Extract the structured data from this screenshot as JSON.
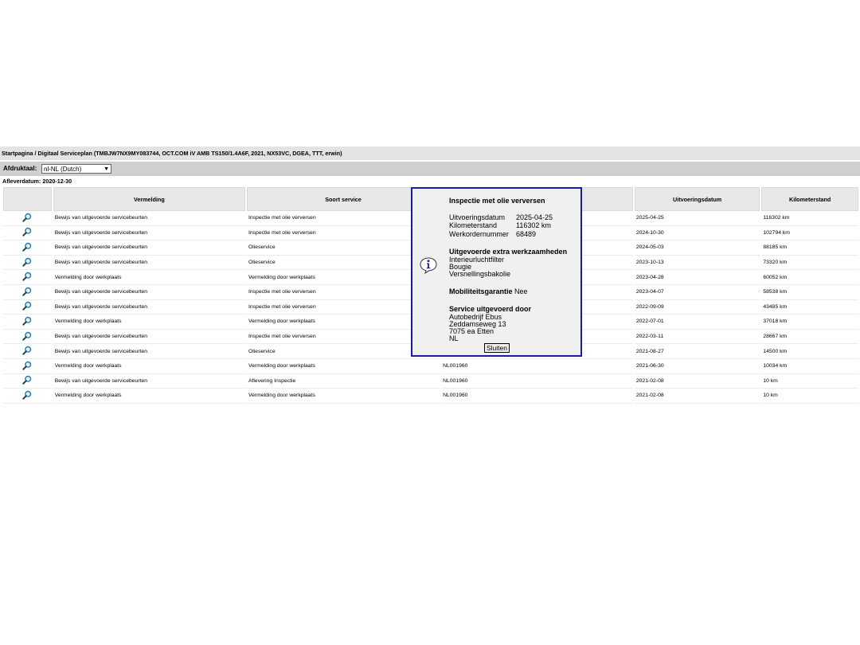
{
  "breadcrumb": "Startpagina / Digitaal Serviceplan (TMBJW7NX9MY083744, OCT.COM iV AMB TS150/1.4A6F, 2021, NX53VC, DGEA, TTT, erwin)",
  "language": {
    "label": "Afdruktaal:",
    "selected": "nl-NL (Dutch)"
  },
  "delivery": "Afleverdatum: 2020-12-30",
  "table": {
    "headers": [
      "",
      "Vermelding",
      "Soort service",
      "",
      "Uitvoeringsdatum",
      "Kilometerstand"
    ],
    "rows": [
      [
        "Bewijs van uitgevoerde servicebeurten",
        "Inspectie met olie verversen",
        "",
        "2025-04-25",
        "116302 km"
      ],
      [
        "Bewijs van uitgevoerde servicebeurten",
        "Inspectie met olie verversen",
        "",
        "2024-10-30",
        "102794 km"
      ],
      [
        "Bewijs van uitgevoerde servicebeurten",
        "Olieservice",
        "",
        "2024-05-03",
        "88185 km"
      ],
      [
        "Bewijs van uitgevoerde servicebeurten",
        "Olieservice",
        "",
        "2023-10-13",
        "73320 km"
      ],
      [
        "Vermelding door werkplaats",
        "Vermelding door werkplaats",
        "",
        "2023-04-28",
        "60052 km"
      ],
      [
        "Bewijs van uitgevoerde servicebeurten",
        "Inspectie met olie verversen",
        "",
        "2023-04-07",
        "58538 km"
      ],
      [
        "Bewijs van uitgevoerde servicebeurten",
        "Inspectie met olie verversen",
        "",
        "2022-09-09",
        "43485 km"
      ],
      [
        "Vermelding door werkplaats",
        "Vermelding door werkplaats",
        "",
        "2022-07-01",
        "37018 km"
      ],
      [
        "Bewijs van uitgevoerde servicebeurten",
        "Inspectie met olie verversen",
        "",
        "2022-03-11",
        "28667 km"
      ],
      [
        "Bewijs van uitgevoerde servicebeurten",
        "Olieservice",
        "",
        "2021-08-27",
        "14500 km"
      ],
      [
        "Vermelding door werkplaats",
        "Vermelding door werkplaats",
        "NL001960",
        "2021-06-30",
        "10034 km"
      ],
      [
        "Bewijs van uitgevoerde servicebeurten",
        "Aflevering Inspectie",
        "NL001960",
        "2021-02-08",
        "10 km"
      ],
      [
        "Vermelding door werkplaats",
        "Vermelding door werkplaats",
        "NL001960",
        "2021-02-08",
        "10 km"
      ]
    ]
  },
  "popup": {
    "title": "Inspectie met olie verversen",
    "fields": [
      {
        "label": "Uitvoeringsdatum",
        "value": "2025-04-25"
      },
      {
        "label": "Kilometerstand",
        "value": "116302 km"
      },
      {
        "label": "Werkordernummer",
        "value": "68489"
      }
    ],
    "extra_title": "Uitgevoerde extra werkzaamheden",
    "extra_items": [
      "Interieurluchtfilter",
      "Bougie",
      "Versnellingsbakolie"
    ],
    "mobility_label": "Mobiliteitsgarantie",
    "mobility_value": "Nee",
    "service_title": "Service uitgevoerd door",
    "service_lines": [
      "Autobedrijf Ebus",
      "Zeddamseweg 13",
      "7075 ea Etten",
      "NL"
    ],
    "close_label": "Sluiten"
  },
  "icons": {
    "row_icon": "magnifier-icon",
    "popup_icon": "info-icon"
  },
  "colors": {
    "popup_border": "#1a1aa8",
    "magnifier": "#1f7bb8"
  }
}
